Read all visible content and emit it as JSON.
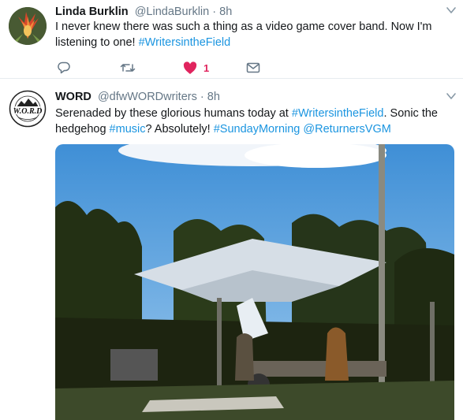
{
  "tweets": [
    {
      "name": "Linda Burklin",
      "handle": "@LindaBurklin",
      "dot": "·",
      "time": "8h",
      "text_plain": "I  never knew there was such a thing as a video game cover band. Now I'm listening to one! ",
      "text_tag": "#WritersintheField",
      "avatar_icon": "flower-avatar",
      "actions": {
        "reply_icon": "reply-icon",
        "retweet_icon": "retweet-icon",
        "like_icon": "heart-filled-icon",
        "like_count": "1",
        "message_icon": "direct-message-icon"
      }
    },
    {
      "name": "WORD",
      "handle": "@dfwWORDwriters",
      "dot": "·",
      "time": "8h",
      "text_1": "Serenaded by these glorious humans today at ",
      "tag_1": "#WritersintheField",
      "text_2": ". Sonic the hedgehog ",
      "tag_2": "#music",
      "text_3": "? Absolutely! ",
      "tag_3": "#SundayMorning",
      "text_4": " ",
      "tag_4": "@ReturnersVGM",
      "avatar_icon": "word-logo-avatar",
      "avatar_logo_text": "W.O.R.D",
      "media_icon": "photo-outdoor-band-under-canopy"
    }
  ],
  "colors": {
    "link": "#1b95e0",
    "like": "#e0245e",
    "muted": "#657786",
    "border": "#e6ecf0"
  }
}
